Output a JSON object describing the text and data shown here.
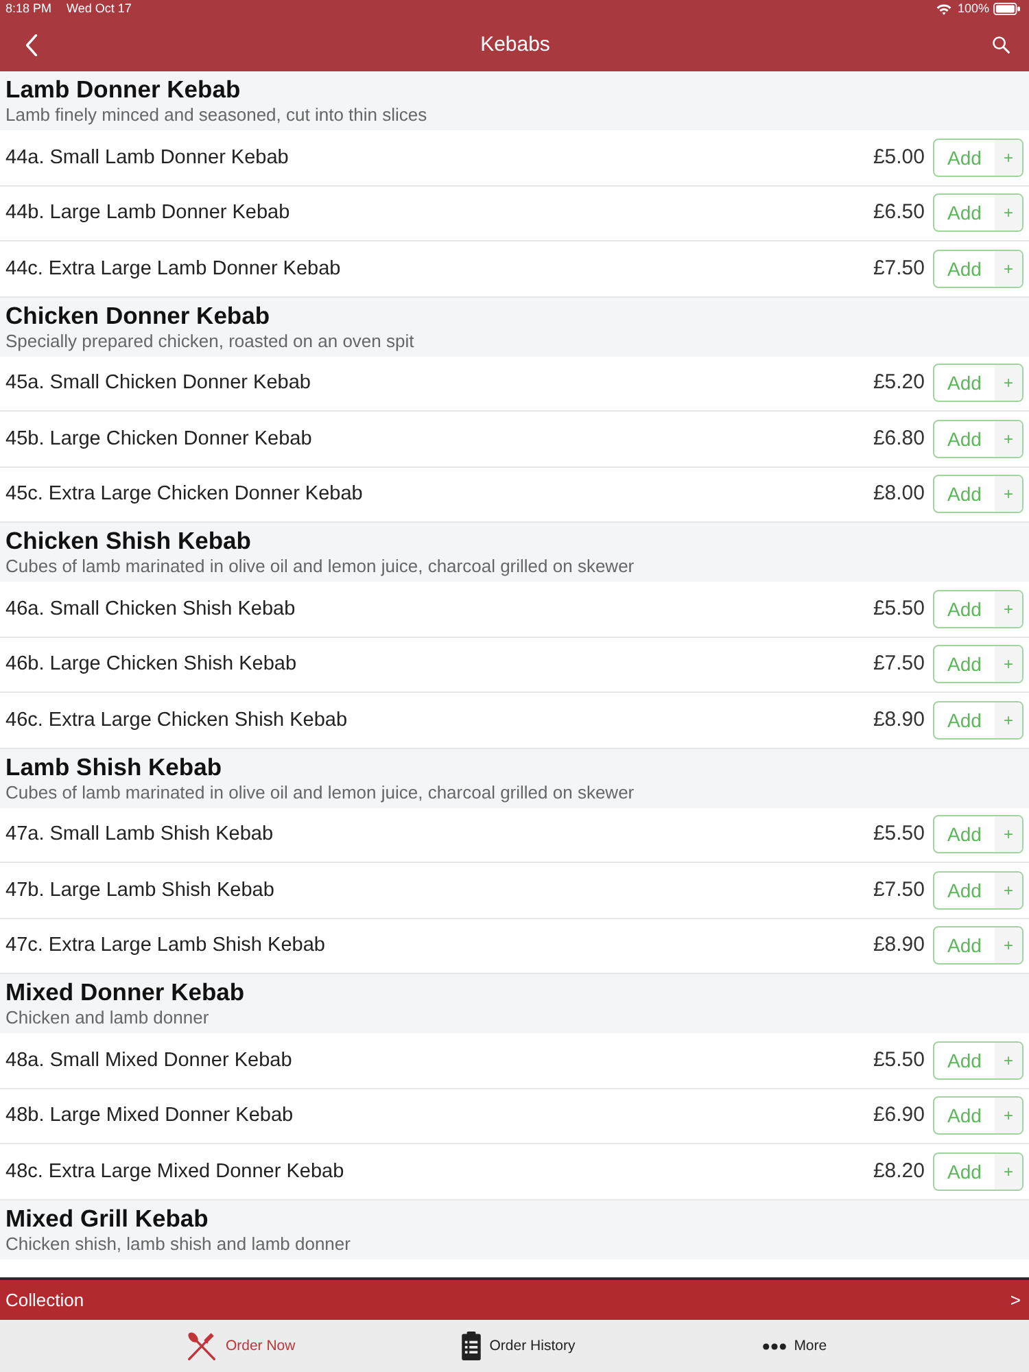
{
  "status_bar": {
    "time": "8:18 PM",
    "date": "Wed Oct 17",
    "battery": "100%"
  },
  "nav_bar": {
    "title": "Kebabs"
  },
  "sections": [
    {
      "title": "Lamb Donner Kebab",
      "description": "Lamb finely minced and seasoned, cut into thin slices",
      "items": [
        {
          "name": "44a. Small Lamb Donner Kebab",
          "price": "£5.00",
          "button": "Add",
          "button_icon": "+"
        },
        {
          "name": "44b. Large Lamb Donner Kebab",
          "price": "£6.50",
          "button": "Add",
          "button_icon": "+"
        },
        {
          "name": "44c. Extra Large Lamb Donner Kebab",
          "price": "£7.50",
          "button": "Add",
          "button_icon": "+"
        }
      ]
    },
    {
      "title": "Chicken Donner Kebab",
      "description": "Specially prepared chicken, roasted on an oven spit",
      "items": [
        {
          "name": "45a. Small Chicken Donner Kebab",
          "price": "£5.20",
          "button": "Add",
          "button_icon": "+"
        },
        {
          "name": "45b. Large Chicken Donner Kebab",
          "price": "£6.80",
          "button": "Add",
          "button_icon": "+"
        },
        {
          "name": "45c. Extra Large Chicken Donner Kebab",
          "price": "£8.00",
          "button": "Add",
          "button_icon": "+"
        }
      ]
    },
    {
      "title": "Chicken Shish Kebab",
      "description": "Cubes of lamb marinated in olive oil and lemon juice, charcoal grilled on skewer",
      "items": [
        {
          "name": "46a. Small Chicken Shish Kebab",
          "price": "£5.50",
          "button": "Add",
          "button_icon": "+"
        },
        {
          "name": "46b. Large Chicken Shish Kebab",
          "price": "£7.50",
          "button": "Add",
          "button_icon": "+"
        },
        {
          "name": "46c. Extra Large Chicken Shish Kebab",
          "price": "£8.90",
          "button": "Add",
          "button_icon": "+"
        }
      ]
    },
    {
      "title": "Lamb Shish Kebab",
      "description": "Cubes of lamb marinated in olive oil and lemon juice, charcoal grilled on skewer",
      "items": [
        {
          "name": "47a. Small Lamb Shish Kebab",
          "price": "£5.50",
          "button": "Add",
          "button_icon": "+"
        },
        {
          "name": "47b. Large Lamb Shish Kebab",
          "price": "£7.50",
          "button": "Add",
          "button_icon": "+"
        },
        {
          "name": "47c. Extra Large Lamb Shish Kebab",
          "price": "£8.90",
          "button": "Add",
          "button_icon": "+"
        }
      ]
    },
    {
      "title": "Mixed Donner Kebab",
      "description": "Chicken and lamb donner",
      "items": [
        {
          "name": "48a. Small Mixed Donner Kebab",
          "price": "£5.50",
          "button": "Add",
          "button_icon": "+"
        },
        {
          "name": "48b. Large Mixed Donner Kebab",
          "price": "£6.90",
          "button": "Add",
          "button_icon": "+"
        },
        {
          "name": "48c. Extra Large Mixed Donner Kebab",
          "price": "£8.20",
          "button": "Add",
          "button_icon": "+"
        }
      ]
    },
    {
      "title": "Mixed Grill Kebab",
      "description": "Chicken shish, lamb shish and lamb donner"
    }
  ],
  "collection_bar": {
    "label": "Collection",
    "chevron": ">"
  },
  "tab_bar": {
    "tabs": [
      {
        "label": "Order Now",
        "selected": true
      },
      {
        "label": "Order History",
        "selected": false
      },
      {
        "label": "More",
        "selected": false
      }
    ]
  }
}
